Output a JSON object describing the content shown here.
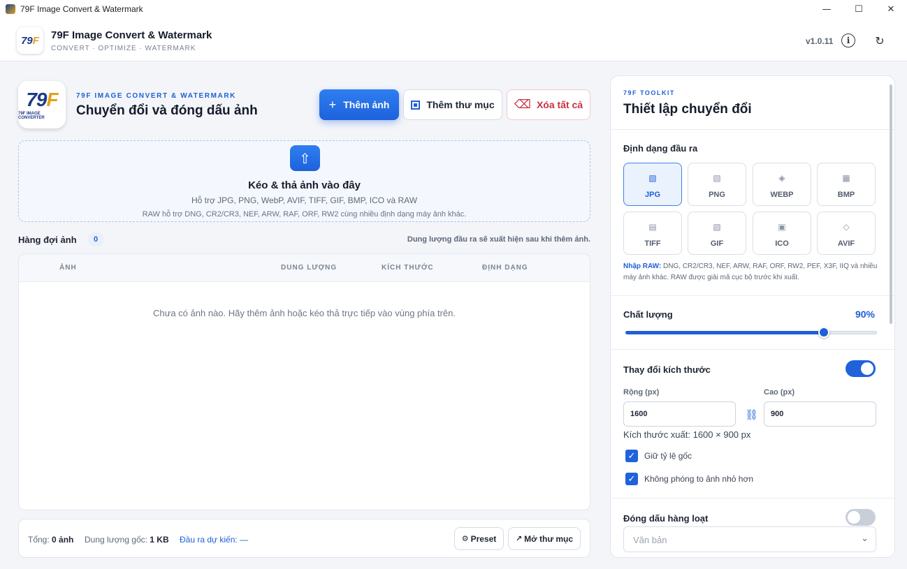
{
  "window": {
    "title": "79F Image Convert & Watermark",
    "minimize_glyph": "—",
    "maximize_glyph": "☐",
    "close_glyph": "✕"
  },
  "header": {
    "app_name": "79F Image Convert & Watermark",
    "subtitle": "CONVERT · OPTIMIZE · WATERMARK",
    "version": "v1.0.11",
    "info_glyph": "i",
    "refresh_glyph": "↻"
  },
  "logo": {
    "mark_main": "79",
    "mark_accent": "F",
    "caption": "79F IMAGE CONVERTER"
  },
  "hero": {
    "eyebrow": "79F IMAGE CONVERT & WATERMARK",
    "title": "Chuyển đổi và đóng dấu ảnh"
  },
  "actions": {
    "add_icon": "+",
    "add_label": "Thêm ảnh",
    "folder_label": "Thêm thư mục",
    "clear_icon": "⌫",
    "clear_label": "Xóa tất cả"
  },
  "dropzone": {
    "icon": "⇧",
    "title": "Kéo & thả ảnh vào đây",
    "line1": "Hỗ trợ JPG, PNG, WebP, AVIF, TIFF, GIF, BMP, ICO và RAW",
    "line2": "RAW hỗ trợ DNG, CR2/CR3, NEF, ARW, RAF, ORF, RW2 cùng nhiều định dạng máy ảnh khác."
  },
  "queue": {
    "label": "Hàng đợi ảnh",
    "count": "0",
    "note": "Dung lượng đầu ra sẽ xuất hiện sau khi thêm ảnh.",
    "columns": [
      "ẢNH",
      "DUNG LƯỢNG",
      "KÍCH THƯỚC",
      "ĐỊNH DẠNG"
    ],
    "empty_text": "Chưa có ảnh nào. Hãy thêm ảnh hoặc kéo thả trực tiếp vào vùng phía trên."
  },
  "footer": {
    "total_label": "Tổng:",
    "total_value": "0 ảnh",
    "orig_label": "Dung lượng gốc:",
    "orig_value": "1 KB",
    "output_label": "Đầu ra dự kiến: —",
    "preset_icon": "⚙",
    "preset_label": "Preset",
    "open_icon": "↗",
    "open_label": "Mở thư mục"
  },
  "panel": {
    "eyebrow": "79F TOOLKIT",
    "title": "Thiết lập chuyển đổi",
    "output_format_label": "Định dạng đầu ra",
    "formats": [
      {
        "label": "JPG",
        "glyph": "▧"
      },
      {
        "label": "PNG",
        "glyph": "▧"
      },
      {
        "label": "WEBP",
        "glyph": "◈"
      },
      {
        "label": "BMP",
        "glyph": "▦"
      },
      {
        "label": "TIFF",
        "glyph": "▤"
      },
      {
        "label": "GIF",
        "glyph": "▧"
      },
      {
        "label": "ICO",
        "glyph": "▣"
      },
      {
        "label": "AVIF",
        "glyph": "◇"
      }
    ],
    "selected_format": "JPG",
    "raw_label": "Nhập RAW:",
    "raw_text": "DNG, CR2/CR3, NEF, ARW, RAF, ORF, RW2, PEF, X3F, IIQ và nhiều máy ảnh khác. RAW được giải mã cục bộ trước khi xuất.",
    "quality_label": "Chất lượng",
    "quality_text": "90%",
    "quality_value": 90,
    "resize_label": "Thay đổi kích thước",
    "resize_enabled": true,
    "width_label": "Rộng (px)",
    "width_value": "1600",
    "height_label": "Cao (px)",
    "height_value": "900",
    "link_glyph": "⛓",
    "output_size": "Kích thước xuất: 1600 × 900 px",
    "check_glyph": "✓",
    "keep_ratio_label": "Giữ tỷ lệ gốc",
    "no_upscale_label": "Không phóng to ảnh nhỏ hơn",
    "watermark_label": "Đóng dấu hàng loạt",
    "watermark_enabled": false,
    "watermark_type": "Văn bản",
    "select_chevron": "⌄"
  }
}
